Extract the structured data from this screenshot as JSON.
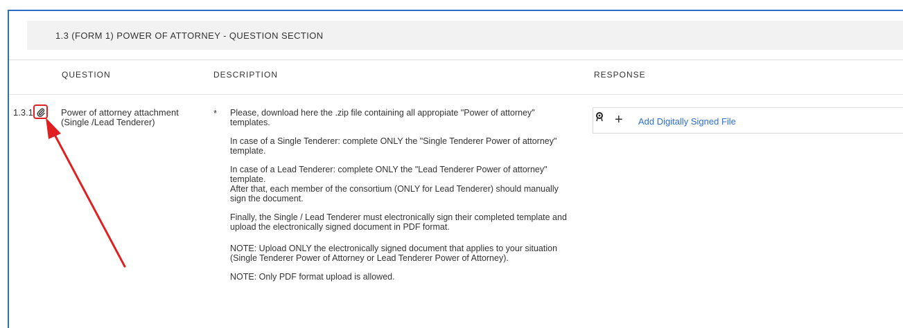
{
  "section": {
    "title": "1.3  (FORM 1) POWER OF ATTORNEY - QUESTION SECTION"
  },
  "columns": {
    "question": "QUESTION",
    "description": "DESCRIPTION",
    "response": "RESPONSE"
  },
  "question_row": {
    "number": "1.3.1",
    "question_line1": "Power of attorney attachment",
    "question_line2": "(Single /Lead Tenderer)",
    "required_marker": "*",
    "description": [
      "Please, download here the .zip file containing all appropiate \"Power of attorney\" templates.",
      "In case of a Single Tenderer: complete ONLY the \"Single Tenderer Power of attorney\" template.",
      "In case of a Lead Tenderer: complete ONLY the \"Lead Tenderer Power of attorney\" template.",
      "After that, each member of the consortium (ONLY for Lead Tenderer) should manually sign the document.",
      "Finally, the Single / Lead Tenderer must electronically sign their completed template and upload the electronically signed document in PDF format.",
      "NOTE: Upload ONLY the electronically signed document that applies to your situation (Single Tenderer Power of Attorney or Lead Tenderer Power of Attorney).",
      "NOTE: Only PDF format upload is allowed."
    ],
    "response": {
      "add_label": "Add Digitally Signed File",
      "plus_symbol": "+"
    }
  },
  "colors": {
    "frame_border": "#2b6cc4",
    "header_bg": "#f2f2f2",
    "link": "#2a6fd6",
    "annotation_red": "#e02020"
  }
}
